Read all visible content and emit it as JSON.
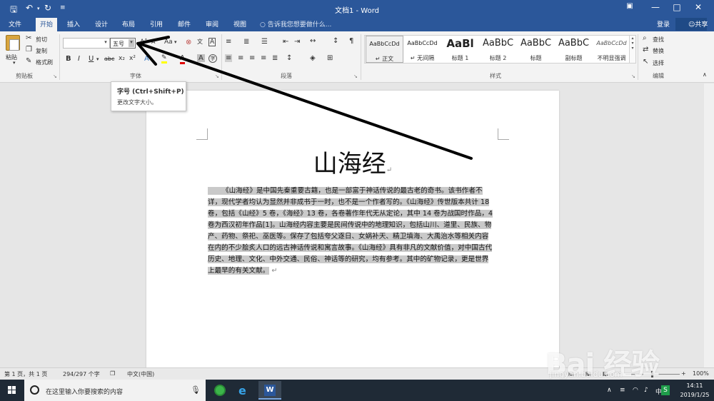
{
  "app": {
    "doc_title": "文档1 - Word"
  },
  "tabs": {
    "file": "文件",
    "home": "开始",
    "insert": "插入",
    "design": "设计",
    "layout": "布局",
    "references": "引用",
    "mailings": "邮件",
    "review": "审阅",
    "view": "视图",
    "tell_me": "告诉我您想要做什么...",
    "sign_in": "登录",
    "share": "共享"
  },
  "clipboard": {
    "paste": "粘贴",
    "cut": "剪切",
    "copy": "复制",
    "format_painter": "格式刷",
    "group_label": "剪贴板"
  },
  "font": {
    "font_name_value": "",
    "font_size_value": "五号",
    "bold": "B",
    "italic": "I",
    "underline": "U",
    "strike": "abc",
    "subscript": "x₂",
    "superscript": "x²",
    "group_label": "字体",
    "change_case": "Aa"
  },
  "paragraph": {
    "group_label": "段落"
  },
  "styles": {
    "group_label": "样式",
    "items": [
      {
        "sample": "AaBbCcDd",
        "name": "↵ 正文"
      },
      {
        "sample": "AaBbCcDd",
        "name": "↵ 无间隔"
      },
      {
        "sample": "AaBl",
        "name": "标题 1"
      },
      {
        "sample": "AaBbC",
        "name": "标题 2"
      },
      {
        "sample": "AaBbC",
        "name": "标题"
      },
      {
        "sample": "AaBbC",
        "name": "副标题"
      },
      {
        "sample": "AaBbCcDd",
        "name": "不明显强调"
      }
    ]
  },
  "editing": {
    "find": "查找",
    "replace": "替换",
    "select": "选择",
    "group_label": "编辑"
  },
  "tooltip": {
    "title": "字号 (Ctrl+Shift+P)",
    "description": "更改文字大小。"
  },
  "document": {
    "heading": "山海经",
    "body": "《山海经》是中国先秦重要古籍，也是一部富于神话传说的最古老的奇书。该书作者不详，现代学者均认为显然并非成书于一时，也不是一个作者写的。《山海经》传世版本共计 18 卷，包括《山经》5 卷，《海经》13 卷，各卷著作年代无从定论，其中 14 卷为战国时作品，4 卷为西汉初年作品[1]。山海经内容主要是民间传说中的地理知识，包括山川、道里、民族、物产、药物、祭祀、巫医等。保存了包括夸父逐日、女娲补天、精卫填海、大禹治水等相关内容在内的不少脍炙人口的远古神话传说和寓言故事。《山海经》具有非凡的文献价值，对中国古代历史、地理、文化、中外交通、民俗、神话等的研究，均有参考。其中的矿物记录，更是世界上最早的有关文献。"
  },
  "status": {
    "page": "第 1 页，共 1 页",
    "words": "294/297 个字",
    "language": "中文(中国)",
    "zoom": "100%"
  },
  "taskbar": {
    "search_placeholder": "在这里输入你要搜索的内容",
    "time": "14:11",
    "date": "2019/1/25"
  },
  "watermark": {
    "brand": "Bai 经验",
    "sub": "jingyan.baidu.com"
  },
  "colors": {
    "word_blue": "#2b579a",
    "selection": "#c9c9c9",
    "annotation_arrow": "#000000"
  }
}
